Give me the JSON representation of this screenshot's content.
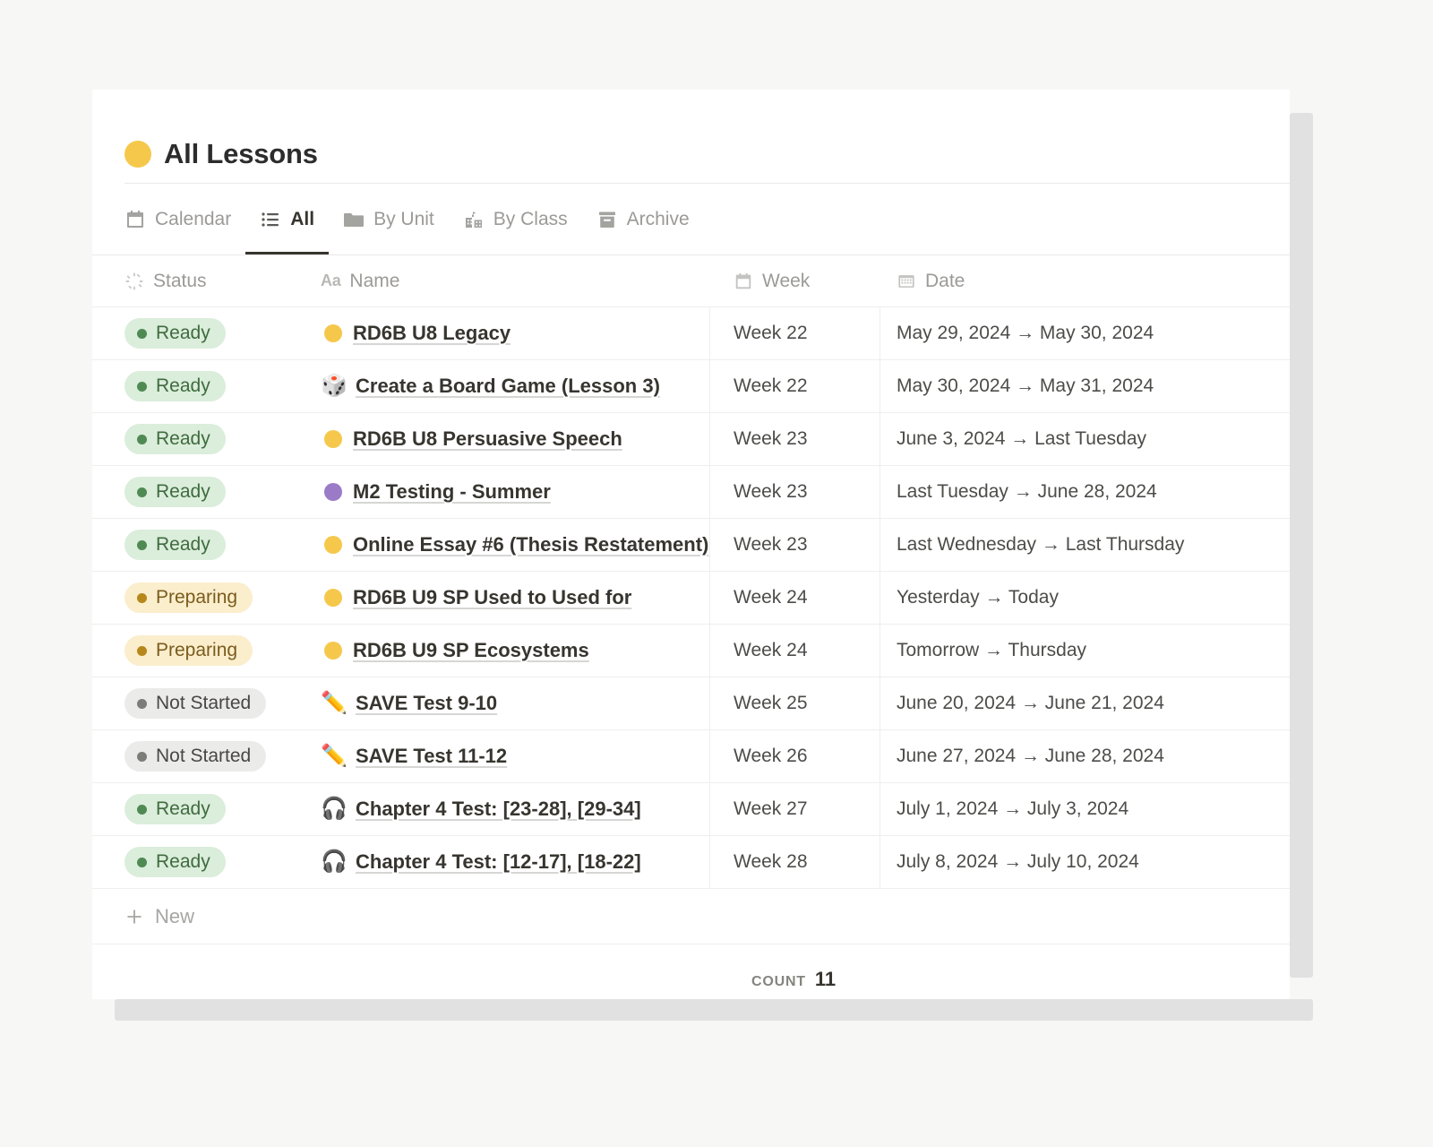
{
  "page": {
    "title": "All Lessons",
    "title_dot_color": "#f5c84c",
    "background_color": "#f7f7f6",
    "card_color": "#ffffff"
  },
  "tabs": [
    {
      "label": "Calendar",
      "icon": "calendar-icon",
      "active": false
    },
    {
      "label": "All",
      "icon": "list-icon",
      "active": true
    },
    {
      "label": "By Unit",
      "icon": "folder-icon",
      "active": false
    },
    {
      "label": "By Class",
      "icon": "school-icon",
      "active": false
    },
    {
      "label": "Archive",
      "icon": "archive-icon",
      "active": false
    }
  ],
  "table": {
    "columns": [
      {
        "label": "Status",
        "icon": "spinner-icon"
      },
      {
        "label": "Name",
        "icon": "aa-text-icon"
      },
      {
        "label": "Week",
        "icon": "calendar-icon"
      },
      {
        "label": "Date",
        "icon": "date-icon"
      }
    ],
    "rows": [
      {
        "status": "Ready",
        "status_type": "ready",
        "icon": "yellow-circle",
        "icon_color": "#f5c84c",
        "name": "RD6B U8 Legacy",
        "week": "Week 22",
        "date": "May 29, 2024 → May 30, 2024"
      },
      {
        "status": "Ready",
        "status_type": "ready",
        "icon": "game-die-emoji",
        "emoji": "🎲",
        "name": "Create a Board Game (Lesson 3)",
        "week": "Week 22",
        "date": "May 30, 2024 → May 31, 2024"
      },
      {
        "status": "Ready",
        "status_type": "ready",
        "icon": "yellow-circle",
        "icon_color": "#f5c84c",
        "name": "RD6B U8 Persuasive Speech",
        "week": "Week 23",
        "date": "June 3, 2024 → Last Tuesday"
      },
      {
        "status": "Ready",
        "status_type": "ready",
        "icon": "purple-circle",
        "icon_color": "#9b7bc8",
        "name": "M2 Testing - Summer",
        "week": "Week 23",
        "date": "Last Tuesday → June 28, 2024"
      },
      {
        "status": "Ready",
        "status_type": "ready",
        "icon": "yellow-circle",
        "icon_color": "#f5c84c",
        "name": "Online Essay #6 (Thesis Restatement)",
        "week": "Week 23",
        "date": "Last Wednesday → Last Thursday"
      },
      {
        "status": "Preparing",
        "status_type": "preparing",
        "icon": "yellow-circle",
        "icon_color": "#f5c84c",
        "name": "RD6B U9 SP Used to Used for",
        "week": "Week 24",
        "date": "Yesterday → Today"
      },
      {
        "status": "Preparing",
        "status_type": "preparing",
        "icon": "yellow-circle",
        "icon_color": "#f5c84c",
        "name": "RD6B U9 SP Ecosystems",
        "week": "Week 24",
        "date": "Tomorrow → Thursday"
      },
      {
        "status": "Not Started",
        "status_type": "notstarted",
        "icon": "pencil-emoji",
        "emoji": "✏️",
        "name": "SAVE Test 9-10",
        "week": "Week 25",
        "date": "June 20, 2024 → June 21, 2024"
      },
      {
        "status": "Not Started",
        "status_type": "notstarted",
        "icon": "pencil-emoji",
        "emoji": "✏️",
        "name": "SAVE Test 11-12",
        "week": "Week 26",
        "date": "June 27, 2024 → June 28, 2024"
      },
      {
        "status": "Ready",
        "status_type": "ready",
        "icon": "headphone-emoji",
        "emoji": "🎧",
        "name": "Chapter 4 Test: [23-28], [29-34]",
        "week": "Week 27",
        "date": "July 1, 2024 → July 3, 2024"
      },
      {
        "status": "Ready",
        "status_type": "ready",
        "icon": "headphone-emoji",
        "emoji": "🎧",
        "name": "Chapter 4 Test: [12-17], [18-22]",
        "week": "Week 28",
        "date": "July 8, 2024 → July 10, 2024"
      }
    ]
  },
  "new_row": {
    "label": "New",
    "icon": "plus-icon"
  },
  "footer": {
    "count_label": "COUNT",
    "count_value": "11"
  },
  "status_colors": {
    "ready_bg": "#dbeddb",
    "ready_dot": "#4f8a53",
    "preparing_bg": "#fbeecd",
    "preparing_dot": "#b6871a",
    "notstarted_bg": "#ebebea",
    "notstarted_dot": "#7c7c79"
  }
}
